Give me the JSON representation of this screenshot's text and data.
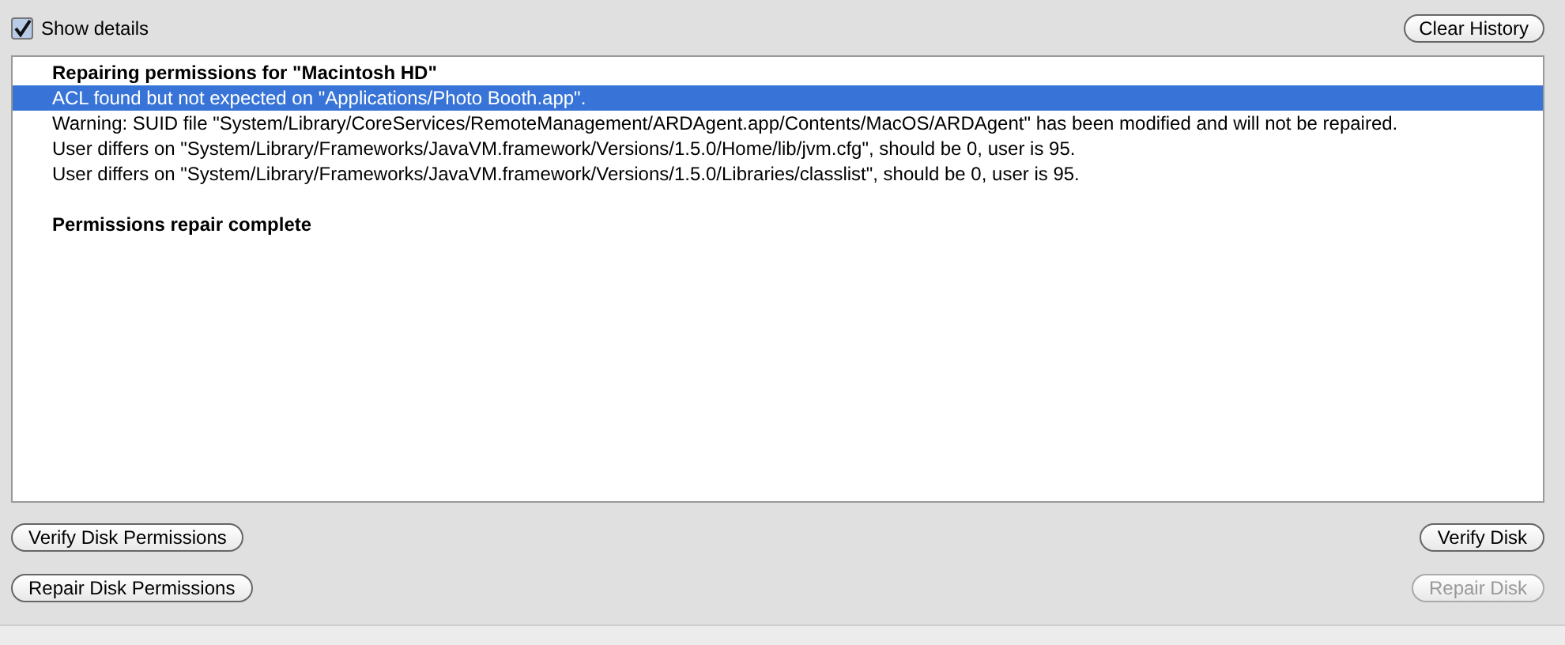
{
  "show_details": {
    "label": "Show details",
    "checked": true
  },
  "clear_history_button": {
    "label": "Clear History"
  },
  "log": [
    {
      "text": "Repairing permissions for \"Macintosh HD\"",
      "kind": "heading",
      "selected": false
    },
    {
      "text": "ACL found but not expected on \"Applications/Photo Booth.app\".",
      "kind": "line",
      "selected": true
    },
    {
      "text": "Warning: SUID file \"System/Library/CoreServices/RemoteManagement/ARDAgent.app/Contents/MacOS/ARDAgent\" has been modified and will not be repaired.",
      "kind": "line",
      "selected": false
    },
    {
      "text": "User differs on \"System/Library/Frameworks/JavaVM.framework/Versions/1.5.0/Home/lib/jvm.cfg\", should be 0, user is 95.",
      "kind": "line",
      "selected": false
    },
    {
      "text": "User differs on \"System/Library/Frameworks/JavaVM.framework/Versions/1.5.0/Libraries/classlist\", should be 0, user is 95.",
      "kind": "line",
      "selected": false
    },
    {
      "kind": "blank"
    },
    {
      "text": "Permissions repair complete",
      "kind": "heading",
      "selected": false
    }
  ],
  "left_buttons": [
    {
      "label": "Verify Disk Permissions",
      "disabled": false
    },
    {
      "label": "Repair Disk Permissions",
      "disabled": false
    }
  ],
  "right_buttons": [
    {
      "label": "Verify Disk",
      "disabled": false
    },
    {
      "label": "Repair Disk",
      "disabled": true
    }
  ]
}
